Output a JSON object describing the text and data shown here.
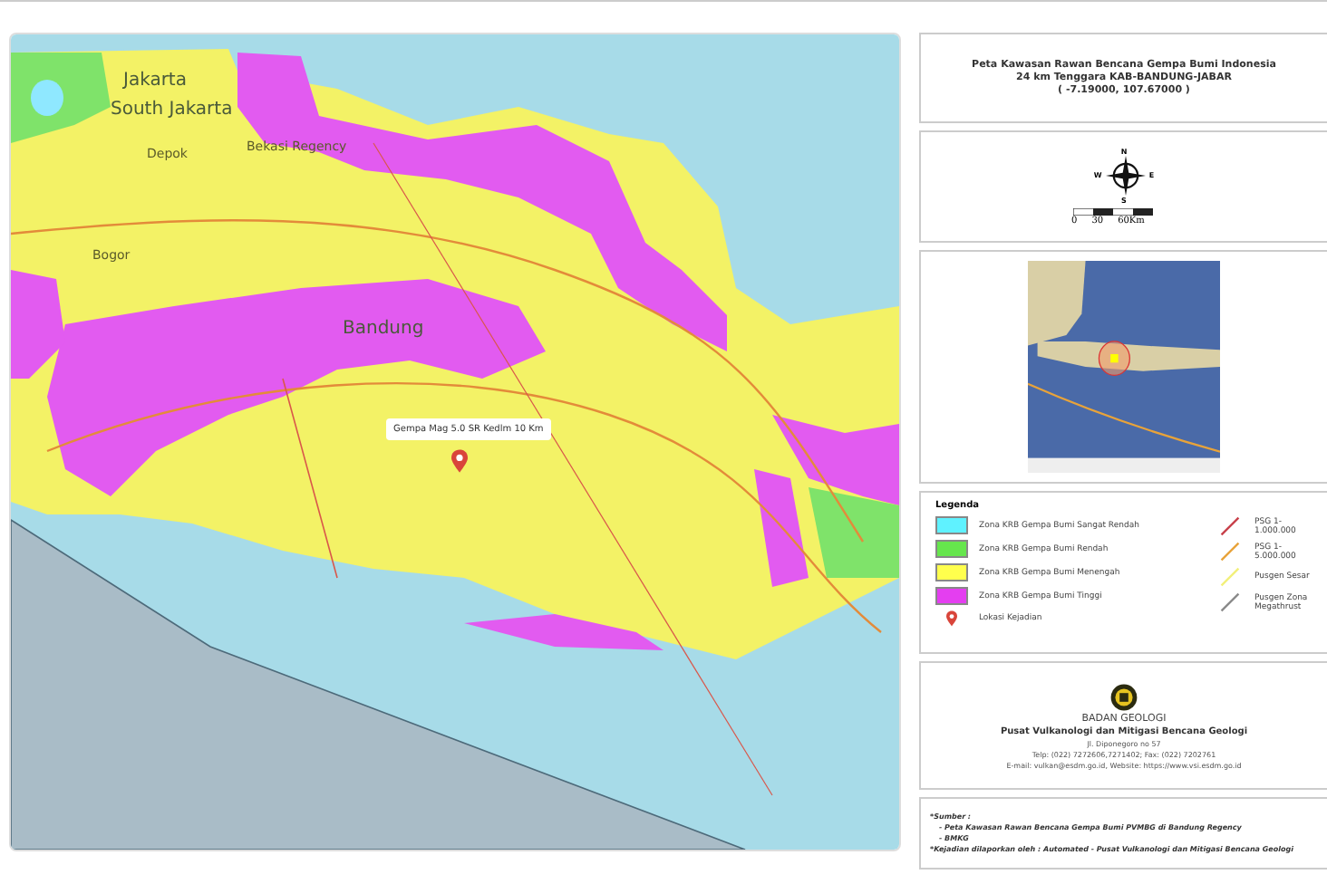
{
  "map": {
    "labels": [
      {
        "text": "Jakarta",
        "kind": "city"
      },
      {
        "text": "South Jakarta",
        "kind": "city"
      },
      {
        "text": "Depok",
        "kind": "town"
      },
      {
        "text": "Bekasi Regency",
        "kind": "town"
      },
      {
        "text": "Bogor",
        "kind": "town"
      },
      {
        "text": "Bandung",
        "kind": "city"
      }
    ],
    "popup": "Gempa Mag 5.0 SR Kedlm 10 Km"
  },
  "title": {
    "lines": [
      "Peta Kawasan Rawan Bencana Gempa Bumi Indonesia",
      "24 km Tenggara KAB-BANDUNG-JABAR",
      "( -7.19000, 107.67000 )"
    ]
  },
  "compass": {
    "north": "N",
    "west": "W",
    "east": "E",
    "south": "S",
    "scale": [
      "0",
      "30",
      "60Km"
    ]
  },
  "legend": {
    "title": "Legenda",
    "items": [
      {
        "kind": "swatch",
        "label": "Zona KRB Gempa Bumi Sangat Rendah",
        "color": "#5ff2ff"
      },
      {
        "kind": "swatch",
        "label": "Zona KRB Gempa Bumi Rendah",
        "color": "#66e64d"
      },
      {
        "kind": "swatch",
        "label": "Zona KRB Gempa Bumi Menengah",
        "color": "#ffff4d"
      },
      {
        "kind": "swatch",
        "label": "Zona KRB Gempa Bumi Tinggi",
        "color": "#e43ef0"
      },
      {
        "kind": "pin",
        "label": "Lokasi Kejadian",
        "color": "#d9453a"
      }
    ],
    "lines": [
      {
        "kind": "line",
        "label": "PSG 1-1.000.000",
        "color": "#c8414b"
      },
      {
        "kind": "line",
        "label": "PSG 1-5.000.000",
        "color": "#e8a33a"
      },
      {
        "kind": "line",
        "label": "Pusgen Sesar",
        "color": "#f2f07a"
      },
      {
        "kind": "line",
        "label": "Pusgen Zona Megathrust",
        "color": "#8a8a8a"
      }
    ]
  },
  "agency": {
    "name": "BADAN GEOLOGI",
    "unit": "Pusat Vulkanologi dan Mitigasi Bencana Geologi",
    "address": "Jl. Diponegoro no 57",
    "phone": "Telp: (022) 7272606,7271402; Fax: (022) 7202761",
    "web": "E-mail: vulkan@esdm.go.id, Website: https://www.vsi.esdm.go.id"
  },
  "notes": {
    "source_title": "*Sumber :",
    "sources": [
      "- Peta Kawasan Rawan Bencana Gempa Bumi PVMBG di Bandung Regency",
      "- BMKG"
    ],
    "reported": "*Kejadian dilaporkan oleh : Automated - Pusat Vulkanologi dan Mitigasi Bencana Geologi"
  }
}
